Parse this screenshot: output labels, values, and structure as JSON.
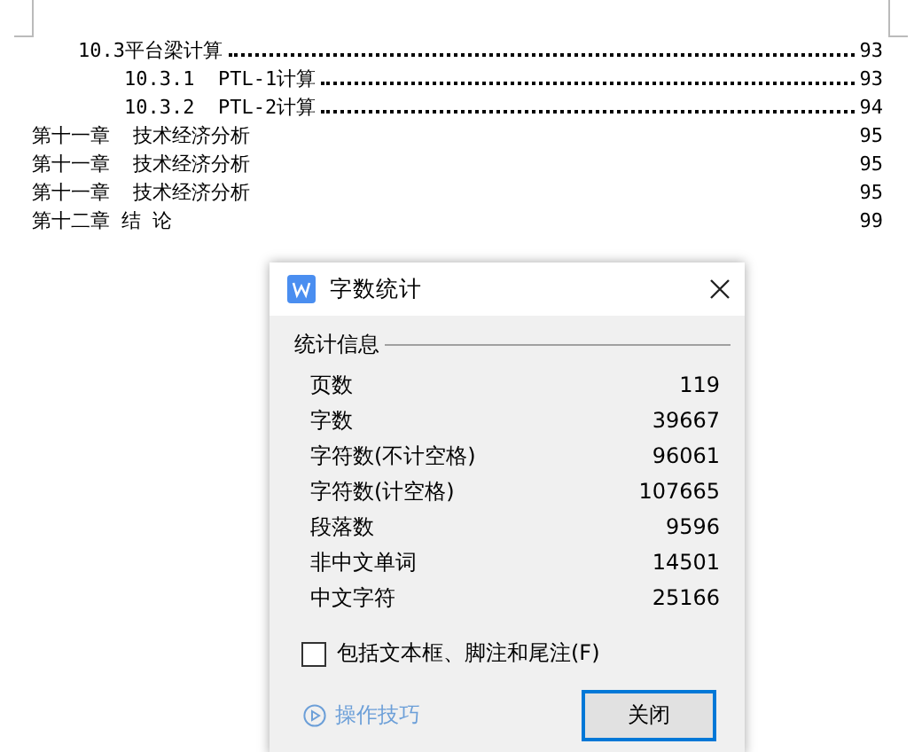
{
  "toc": [
    {
      "kind": "section",
      "text": "10.3平台梁计算",
      "leader": true,
      "page": "93",
      "children": [
        {
          "kind": "section",
          "text": "10.3.1  PTL-1计算",
          "leader": true,
          "page": "93"
        },
        {
          "kind": "section",
          "text": "10.3.2  PTL-2计算",
          "leader": true,
          "page": "94"
        }
      ]
    },
    {
      "kind": "chapter",
      "text": "第十一章  技术经济分析",
      "leader": false,
      "page": "95"
    },
    {
      "kind": "chapter",
      "text": "第十一章  技术经济分析",
      "leader": false,
      "page": "95"
    },
    {
      "kind": "chapter",
      "text": "第十一章  技术经济分析",
      "leader": false,
      "page": "95"
    },
    {
      "kind": "chapter",
      "text": "第十二章 结 论",
      "leader": false,
      "page": "99"
    }
  ],
  "dialog": {
    "title": "字数统计",
    "group_title": "统计信息",
    "stats": [
      {
        "label": "页数",
        "value": "119"
      },
      {
        "label": "字数",
        "value": "39667"
      },
      {
        "label": "字符数(不计空格)",
        "value": "96061"
      },
      {
        "label": "字符数(计空格)",
        "value": "107665"
      },
      {
        "label": "段落数",
        "value": "9596"
      },
      {
        "label": "非中文单词",
        "value": "14501"
      },
      {
        "label": "中文字符",
        "value": "25166"
      }
    ],
    "checkbox": {
      "label": "包括文本框、脚注和尾注(F)",
      "checked": false
    },
    "tips_link": "操作技巧",
    "close_button": "关闭"
  }
}
